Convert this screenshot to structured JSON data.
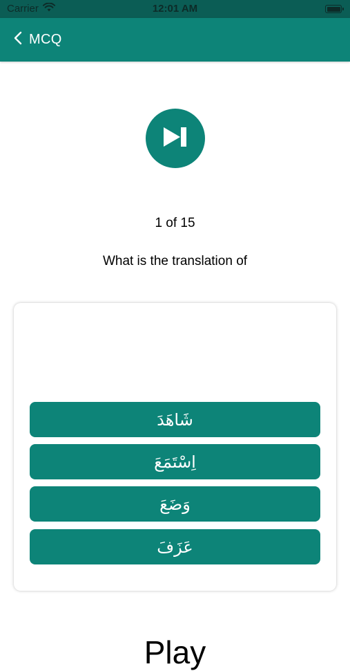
{
  "status_bar": {
    "carrier": "Carrier",
    "time": "12:01 AM",
    "icons": [
      "wifi-icon",
      "battery-icon"
    ]
  },
  "nav": {
    "back_icon": "chevron-left-icon",
    "title": "MCQ"
  },
  "player": {
    "icon": "skip-next-icon"
  },
  "quiz": {
    "progress": "1 of 15",
    "question": "What is the translation of",
    "word": "Play",
    "options": [
      {
        "label": "شَاهَدَ"
      },
      {
        "label": "اِسْتَمَعَ"
      },
      {
        "label": "وَضَعَ"
      },
      {
        "label": "عَزَفَ"
      }
    ]
  },
  "colors": {
    "primary": "#0d8478",
    "status_bar": "#0b5d55",
    "background": "#ffffff",
    "text": "#000000"
  }
}
